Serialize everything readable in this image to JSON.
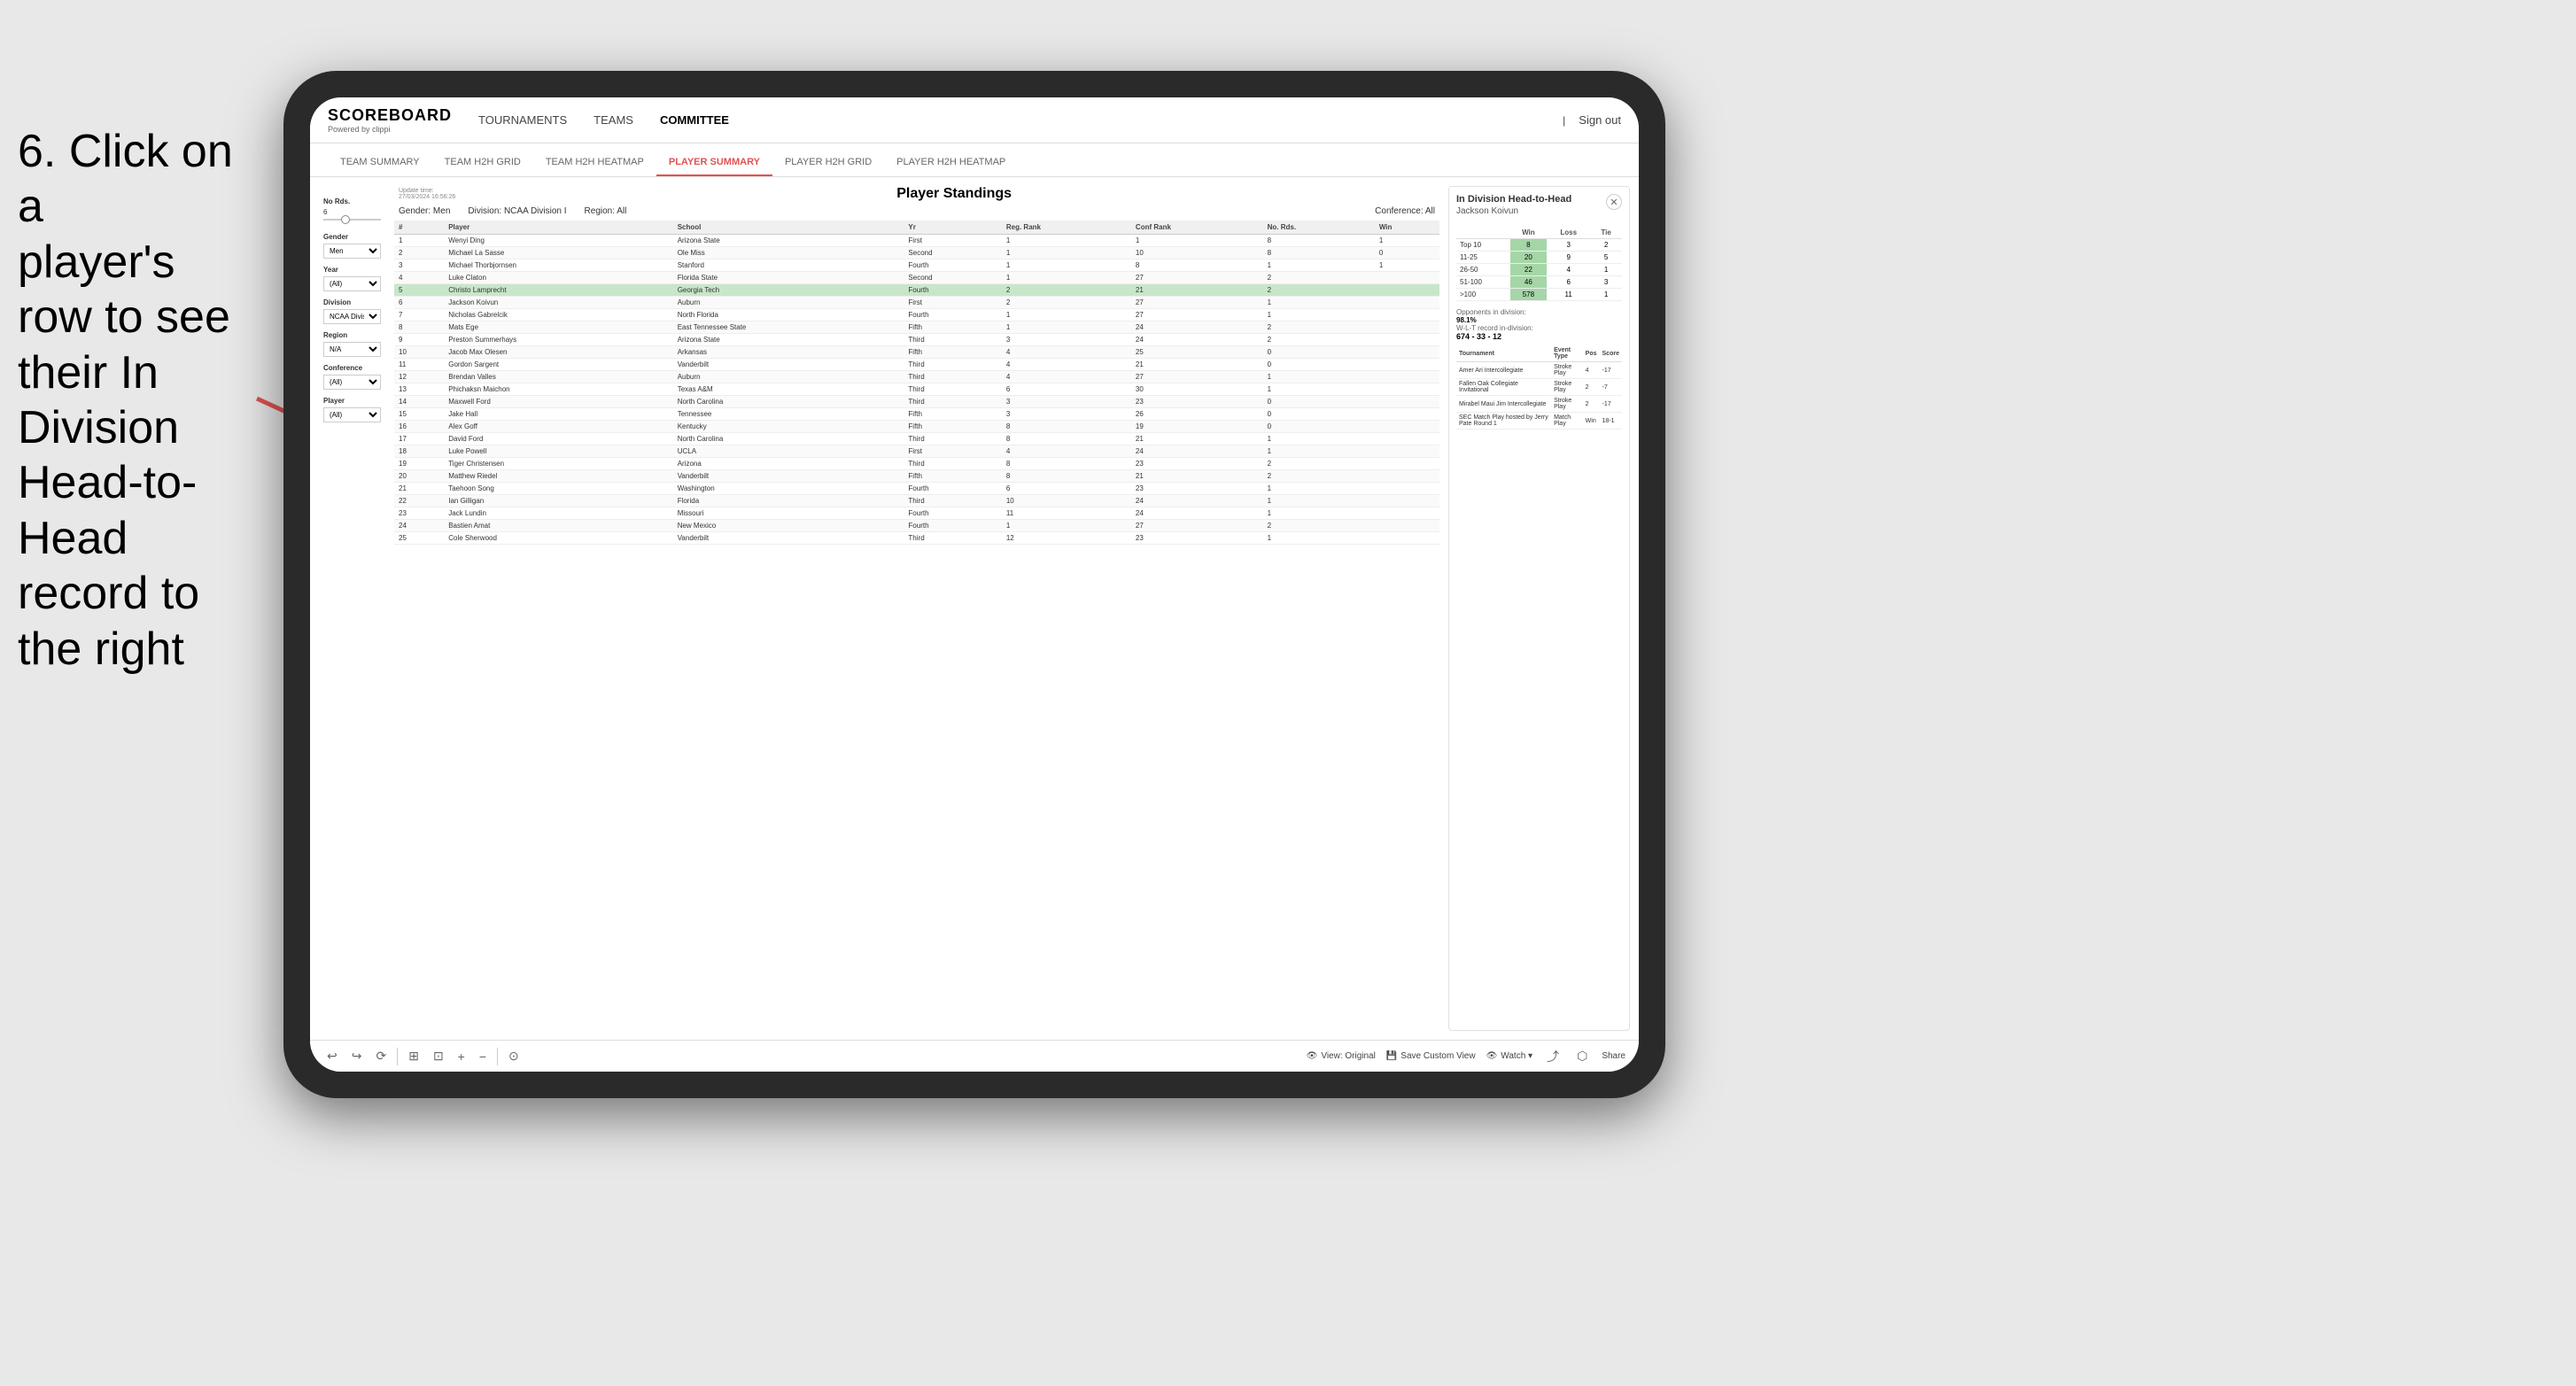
{
  "instruction": {
    "line1": "6. Click on a",
    "line2": "player's row to see",
    "line3": "their In Division",
    "line4": "Head-to-Head",
    "line5": "record to the right"
  },
  "nav": {
    "logo": "SCOREBOARD",
    "logo_sub": "Powered by clippi",
    "links": [
      "TOURNAMENTS",
      "TEAMS",
      "COMMITTEE"
    ],
    "sign_out": "Sign out"
  },
  "sub_tabs": [
    "TEAM SUMMARY",
    "TEAM H2H GRID",
    "TEAM H2H HEATMAP",
    "PLAYER SUMMARY",
    "PLAYER H2H GRID",
    "PLAYER H2H HEATMAP"
  ],
  "active_sub_tab": "PLAYER SUMMARY",
  "filters": {
    "update_label": "Update time:",
    "update_time": "27/03/2024 16:56:26",
    "gender_label": "Gender:",
    "gender_value": "Men",
    "division_label": "Division:",
    "division_value": "NCAA Division I",
    "region_label": "Region:",
    "region_value": "All",
    "conference_label": "Conference:",
    "conference_value": "All"
  },
  "sidebar": {
    "no_rds_label": "No Rds.",
    "no_rds_value": "6",
    "gender_label": "Gender",
    "gender_options": [
      "Men"
    ],
    "gender_selected": "Men",
    "year_label": "Year",
    "year_options": [
      "(All)"
    ],
    "year_selected": "(All)",
    "division_label": "Division",
    "division_options": [
      "NCAA Division I"
    ],
    "division_selected": "NCAA Division I",
    "region_label": "Region",
    "region_options": [
      "N/A"
    ],
    "region_selected": "N/A",
    "conference_label": "Conference",
    "conference_options": [
      "(All)"
    ],
    "conference_selected": "(All)",
    "player_label": "Player",
    "player_options": [
      "(All)"
    ],
    "player_selected": "(All)"
  },
  "table": {
    "title": "Player Standings",
    "columns": [
      "#",
      "Player",
      "School",
      "Yr",
      "Reg. Rank",
      "Conf Rank",
      "No. Rds.",
      "Win"
    ],
    "rows": [
      {
        "num": "1",
        "player": "Wenyi Ding",
        "school": "Arizona State",
        "yr": "First",
        "reg": "1",
        "conf": "1",
        "rds": "8",
        "win": "1"
      },
      {
        "num": "2",
        "player": "Michael La Sasse",
        "school": "Ole Miss",
        "yr": "Second",
        "reg": "1",
        "conf": "10",
        "rds": "8",
        "win": "0"
      },
      {
        "num": "3",
        "player": "Michael Thorbjornsen",
        "school": "Stanford",
        "yr": "Fourth",
        "reg": "1",
        "conf": "8",
        "rds": "1",
        "win": "1"
      },
      {
        "num": "4",
        "player": "Luke Claton",
        "school": "Florida State",
        "yr": "Second",
        "reg": "1",
        "conf": "27",
        "rds": "2",
        "win": ""
      },
      {
        "num": "5",
        "player": "Christo Lamprecht",
        "school": "Georgia Tech",
        "yr": "Fourth",
        "reg": "2",
        "conf": "21",
        "rds": "2",
        "win": ""
      },
      {
        "num": "6",
        "player": "Jackson Koivun",
        "school": "Auburn",
        "yr": "First",
        "reg": "2",
        "conf": "27",
        "rds": "1",
        "win": ""
      },
      {
        "num": "7",
        "player": "Nicholas Gabrelcik",
        "school": "North Florida",
        "yr": "Fourth",
        "reg": "1",
        "conf": "27",
        "rds": "1",
        "win": ""
      },
      {
        "num": "8",
        "player": "Mats Ege",
        "school": "East Tennessee State",
        "yr": "Fifth",
        "reg": "1",
        "conf": "24",
        "rds": "2",
        "win": ""
      },
      {
        "num": "9",
        "player": "Preston Summerhays",
        "school": "Arizona State",
        "yr": "Third",
        "reg": "3",
        "conf": "24",
        "rds": "2",
        "win": ""
      },
      {
        "num": "10",
        "player": "Jacob Max Olesen",
        "school": "Arkansas",
        "yr": "Fifth",
        "reg": "4",
        "conf": "25",
        "rds": "0",
        "win": ""
      },
      {
        "num": "11",
        "player": "Gordon Sargent",
        "school": "Vanderbilt",
        "yr": "Third",
        "reg": "4",
        "conf": "21",
        "rds": "0",
        "win": ""
      },
      {
        "num": "12",
        "player": "Brendan Valles",
        "school": "Auburn",
        "yr": "Third",
        "reg": "4",
        "conf": "27",
        "rds": "1",
        "win": ""
      },
      {
        "num": "13",
        "player": "Phichaksn Maichon",
        "school": "Texas A&M",
        "yr": "Third",
        "reg": "6",
        "conf": "30",
        "rds": "1",
        "win": ""
      },
      {
        "num": "14",
        "player": "Maxwell Ford",
        "school": "North Carolina",
        "yr": "Third",
        "reg": "3",
        "conf": "23",
        "rds": "0",
        "win": ""
      },
      {
        "num": "15",
        "player": "Jake Hall",
        "school": "Tennessee",
        "yr": "Fifth",
        "reg": "3",
        "conf": "26",
        "rds": "0",
        "win": ""
      },
      {
        "num": "16",
        "player": "Alex Goff",
        "school": "Kentucky",
        "yr": "Fifth",
        "reg": "8",
        "conf": "19",
        "rds": "0",
        "win": ""
      },
      {
        "num": "17",
        "player": "David Ford",
        "school": "North Carolina",
        "yr": "Third",
        "reg": "8",
        "conf": "21",
        "rds": "1",
        "win": ""
      },
      {
        "num": "18",
        "player": "Luke Powell",
        "school": "UCLA",
        "yr": "First",
        "reg": "4",
        "conf": "24",
        "rds": "1",
        "win": ""
      },
      {
        "num": "19",
        "player": "Tiger Christensen",
        "school": "Arizona",
        "yr": "Third",
        "reg": "8",
        "conf": "23",
        "rds": "2",
        "win": ""
      },
      {
        "num": "20",
        "player": "Matthew Riedel",
        "school": "Vanderbilt",
        "yr": "Fifth",
        "reg": "8",
        "conf": "21",
        "rds": "2",
        "win": ""
      },
      {
        "num": "21",
        "player": "Taehoon Song",
        "school": "Washington",
        "yr": "Fourth",
        "reg": "6",
        "conf": "23",
        "rds": "1",
        "win": ""
      },
      {
        "num": "22",
        "player": "Ian Gilligan",
        "school": "Florida",
        "yr": "Third",
        "reg": "10",
        "conf": "24",
        "rds": "1",
        "win": ""
      },
      {
        "num": "23",
        "player": "Jack Lundin",
        "school": "Missouri",
        "yr": "Fourth",
        "reg": "11",
        "conf": "24",
        "rds": "1",
        "win": ""
      },
      {
        "num": "24",
        "player": "Bastien Amat",
        "school": "New Mexico",
        "yr": "Fourth",
        "reg": "1",
        "conf": "27",
        "rds": "2",
        "win": ""
      },
      {
        "num": "25",
        "player": "Cole Sherwood",
        "school": "Vanderbilt",
        "yr": "Third",
        "reg": "12",
        "conf": "23",
        "rds": "1",
        "win": ""
      }
    ],
    "highlighted_row": 5
  },
  "h2h": {
    "title": "In Division Head-to-Head",
    "player_name": "Jackson Koivun",
    "columns": [
      "Win",
      "Loss",
      "Tie"
    ],
    "rows": [
      {
        "range": "Top 10",
        "win": "8",
        "loss": "3",
        "tie": "2"
      },
      {
        "range": "11-25",
        "win": "20",
        "loss": "9",
        "tie": "5"
      },
      {
        "range": "26-50",
        "win": "22",
        "loss": "4",
        "tie": "1"
      },
      {
        "range": "51-100",
        "win": "46",
        "loss": "6",
        "tie": "3"
      },
      {
        "range": ">100",
        "win": "578",
        "loss": "11",
        "tie": "1"
      }
    ],
    "opponents_label": "Opponents in division:",
    "wlt_label": "W-L-T record in-division:",
    "opponents_pct": "98.1%",
    "wlt_record": "674 - 33 - 12",
    "tournament_columns": [
      "Tournament",
      "Event Type",
      "Pos",
      "Score"
    ],
    "tournaments": [
      {
        "name": "Amer Ari Intercollegiate",
        "type": "Stroke Play",
        "pos": "4",
        "score": "-17"
      },
      {
        "name": "Fallen Oak Collegiate Invitational",
        "type": "Stroke Play",
        "pos": "2",
        "score": "-7"
      },
      {
        "name": "Mirabel Maui Jim Intercollegiate",
        "type": "Stroke Play",
        "pos": "2",
        "score": "-17"
      },
      {
        "name": "SEC Match Play hosted by Jerry Pate Round 1",
        "type": "Match Play",
        "pos": "Win",
        "score": "18-1"
      }
    ]
  },
  "toolbar": {
    "undo": "↩",
    "redo": "↪",
    "forward": "⟳",
    "view_original": "View: Original",
    "save_custom": "Save Custom View",
    "watch": "Watch ▾",
    "share": "Share"
  }
}
